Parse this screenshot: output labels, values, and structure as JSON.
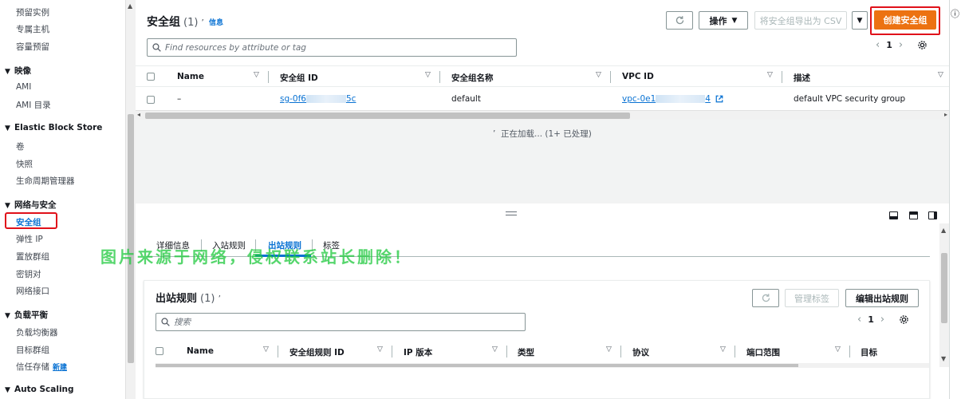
{
  "sidebar": {
    "items_top": [
      "预留实例",
      "专属主机",
      "容量预留"
    ],
    "section_images": {
      "title": "映像",
      "items": [
        "AMI",
        "AMI 目录"
      ]
    },
    "section_ebs": {
      "title": "Elastic Block Store",
      "items": [
        "卷",
        "快照",
        "生命周期管理器"
      ]
    },
    "section_network": {
      "title": "网络与安全",
      "items": [
        "安全组",
        "弹性 IP",
        "置放群组",
        "密钥对",
        "网络接口"
      ]
    },
    "section_lb": {
      "title": "负载平衡",
      "items": [
        "负载均衡器",
        "目标群组",
        "信任存储"
      ],
      "new_badge": "新建"
    },
    "section_autoscaling": {
      "title": "Auto Scaling"
    }
  },
  "header": {
    "title": "安全组",
    "count": "(1)",
    "info": "信息",
    "refresh_icon": "refresh-icon",
    "actions_label": "操作",
    "export_label": "将安全组导出为 CSV",
    "create_label": "创建安全组"
  },
  "search": {
    "placeholder": "Find resources by attribute or tag"
  },
  "pagination": {
    "page": "1"
  },
  "table": {
    "columns": [
      "Name",
      "安全组 ID",
      "安全组名称",
      "VPC ID",
      "描述"
    ],
    "rows": [
      {
        "name": "–",
        "sg_id_start": "sg-0f6",
        "sg_id_end": "5c",
        "sg_name": "default",
        "vpc_start": "vpc-0e1",
        "vpc_end": "4",
        "description": "default VPC security group"
      }
    ]
  },
  "loading_text": "正在加载... (1+ 已处理)",
  "detail": {
    "tabs": [
      "详细信息",
      "入站规则",
      "出站规则",
      "标签"
    ],
    "active_tab": "出站规则",
    "watermark": "图片来源于网络，侵权联系站长删除！",
    "outbound": {
      "title": "出站规则",
      "count": "(1)",
      "manage_tags_label": "管理标签",
      "edit_label": "编辑出站规则",
      "search_placeholder": "搜索",
      "page": "1",
      "columns": [
        "Name",
        "安全组规则 ID",
        "IP 版本",
        "类型",
        "协议",
        "端口范围",
        "目标"
      ]
    }
  },
  "colors": {
    "primary": "#ec7211",
    "link": "#0972d3",
    "highlight": "#e0111a",
    "watermark": "#1ec83c"
  }
}
